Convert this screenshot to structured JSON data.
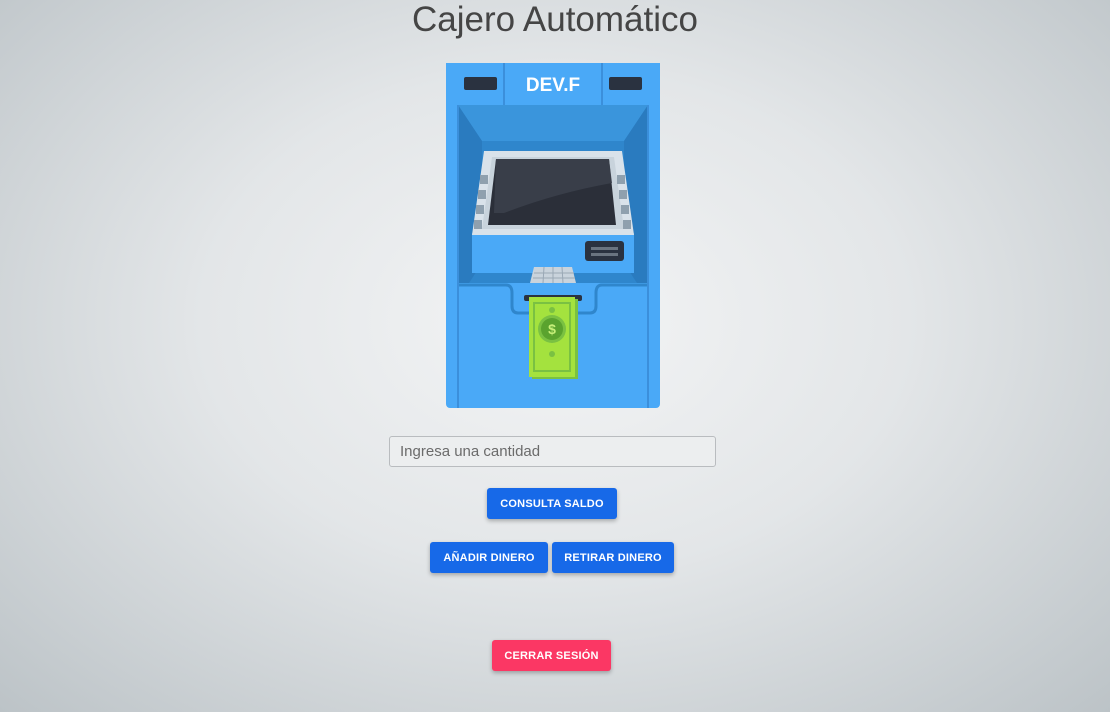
{
  "title": "Cajero Automático",
  "atm": {
    "brand_label": "DEV.F",
    "icon": "atm-machine-illustration"
  },
  "amount": {
    "placeholder": "Ingresa una cantidad",
    "value": ""
  },
  "buttons": {
    "consulta_saldo": "CONSULTA SALDO",
    "anadir_dinero": "AÑADIR DINERO",
    "retirar_dinero": "RETIRAR DINERO",
    "cerrar_sesion": "CERRAR SESIÓN"
  },
  "colors": {
    "primary": "#1769e8",
    "danger": "#fb3764",
    "title": "#454545"
  }
}
